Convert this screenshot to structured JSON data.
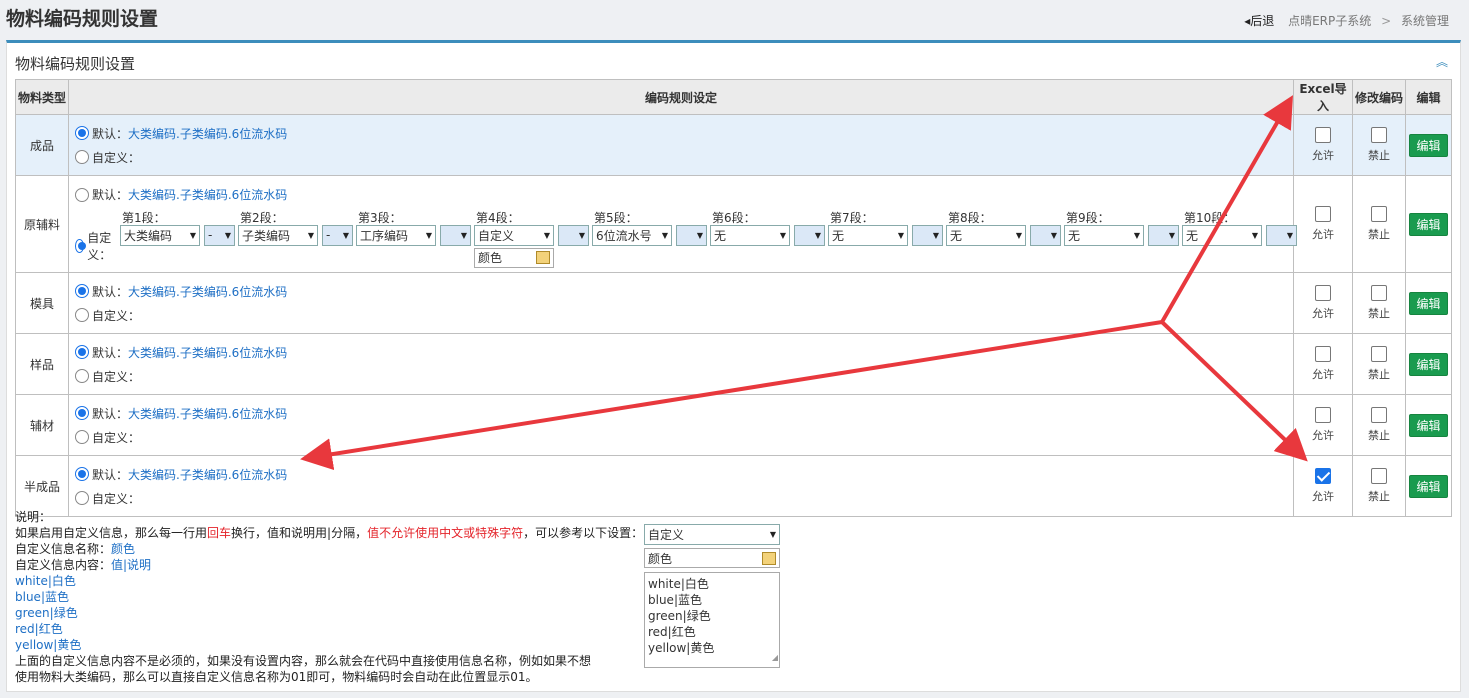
{
  "header": {
    "title": "物料编码规则设置",
    "back_label": "后退",
    "breadcrumb": [
      "点晴ERP子系统",
      "系统管理"
    ],
    "breadcrumb_sep": ">"
  },
  "panel": {
    "title": "物料编码规则设置",
    "collapse_icon": "chevron-up-icon"
  },
  "table": {
    "headers": {
      "type": "物料类型",
      "rule": "编码规则设定",
      "excel": "Excel导入",
      "modify": "修改编码",
      "edit": "编辑"
    },
    "default_prefix": "默认：",
    "default_rule": "大类编码.子类编码.6位流水码",
    "custom_label": "自定义：",
    "allow_label": "允许",
    "forbid_label": "禁止",
    "edit_label": "编辑",
    "rows": [
      {
        "type": "成品",
        "mode": "default",
        "allow": false,
        "forbid": false
      },
      {
        "type": "原辅料",
        "mode": "custom",
        "allow": false,
        "forbid": false
      },
      {
        "type": "模具",
        "mode": "default",
        "allow": false,
        "forbid": false
      },
      {
        "type": "样品",
        "mode": "default",
        "allow": false,
        "forbid": false
      },
      {
        "type": "辅材",
        "mode": "default",
        "allow": false,
        "forbid": false
      },
      {
        "type": "半成品",
        "mode": "default",
        "allow": true,
        "forbid": false
      }
    ],
    "segments": [
      {
        "label": "第1段：",
        "value": "大类编码",
        "sep": "-"
      },
      {
        "label": "第2段：",
        "value": "子类编码",
        "sep": "-"
      },
      {
        "label": "第3段：",
        "value": "工序编码",
        "sep": ""
      },
      {
        "label": "第4段：",
        "value": "自定义",
        "sep": "",
        "extra": "颜色"
      },
      {
        "label": "第5段：",
        "value": "6位流水号",
        "sep": ""
      },
      {
        "label": "第6段：",
        "value": "无",
        "sep": ""
      },
      {
        "label": "第7段：",
        "value": "无",
        "sep": ""
      },
      {
        "label": "第8段：",
        "value": "无",
        "sep": ""
      },
      {
        "label": "第9段：",
        "value": "无",
        "sep": ""
      },
      {
        "label": "第10段：",
        "value": "无",
        "sep": ""
      }
    ]
  },
  "notes": {
    "heading": "说明：",
    "line1_a": "如果启用自定义信息，那么每一行用",
    "line1_red1": "回车",
    "line1_b": "换行，值和说明用|分隔，",
    "line1_red2": "值不允许使用中文或特殊字符",
    "line1_c": "，可以参考以下设置：",
    "name_label": "自定义信息名称：",
    "name_value": "颜色",
    "content_label": "自定义信息内容：",
    "content_value": "值|说明",
    "examples": [
      "white|白色",
      "blue|蓝色",
      "green|绿色",
      "red|红色",
      "yellow|黄色"
    ],
    "footer1": "上面的自定义信息内容不是必须的，如果没有设置内容，那么就会在代码中直接使用信息名称，例如如果不想",
    "footer2": "使用物料大类编码，那么可以直接自定义信息名称为01即可，物料编码时会自动在此位置显示01。"
  },
  "sample": {
    "select_value": "自定义",
    "name_value": "颜色",
    "list": [
      "white|白色",
      "blue|蓝色",
      "green|绿色",
      "red|红色",
      "yellow|黄色"
    ]
  },
  "colors": {
    "accent": "#3c8dbc",
    "edit_button": "#1a9b4f",
    "arrow": "#e8383d",
    "link": "#1e6fc5"
  }
}
